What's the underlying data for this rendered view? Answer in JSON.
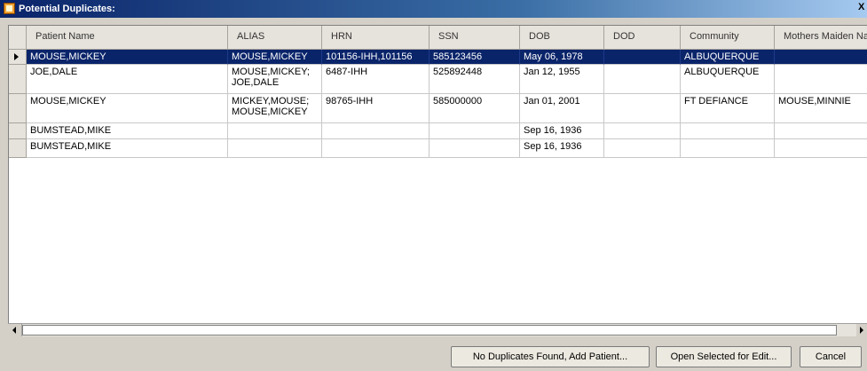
{
  "window": {
    "title": "Potential Duplicates:",
    "close_label": "X"
  },
  "grid": {
    "columns": [
      "Patient Name",
      "ALIAS",
      "HRN",
      "SSN",
      "DOB",
      "DOD",
      "Community",
      "Mothers Maiden Na"
    ],
    "rows": [
      {
        "selected": true,
        "cells": [
          "MOUSE,MICKEY",
          "MOUSE,MICKEY",
          "101156-IHH,101156",
          "585123456",
          "May 06, 1978",
          "",
          "ALBUQUERQUE",
          ""
        ]
      },
      {
        "selected": false,
        "cells": [
          "JOE,DALE",
          "MOUSE,MICKEY; JOE,DALE",
          "6487-IHH",
          "525892448",
          "Jan 12, 1955",
          "",
          "ALBUQUERQUE",
          ""
        ]
      },
      {
        "selected": false,
        "cells": [
          "MOUSE,MICKEY",
          "MICKEY,MOUSE; MOUSE,MICKEY",
          "98765-IHH",
          "585000000",
          "Jan 01, 2001",
          "",
          "FT DEFIANCE",
          "MOUSE,MINNIE"
        ]
      },
      {
        "selected": false,
        "cells": [
          "BUMSTEAD,MIKE",
          "",
          "",
          "",
          "Sep 16, 1936",
          "",
          "",
          ""
        ]
      },
      {
        "selected": false,
        "cells": [
          "BUMSTEAD,MIKE",
          "",
          "",
          "",
          "Sep 16, 1936",
          "",
          "",
          ""
        ]
      }
    ]
  },
  "buttons": {
    "no_duplicates": "No Duplicates Found, Add Patient...",
    "open_selected": "Open Selected for Edit...",
    "cancel": "Cancel"
  }
}
